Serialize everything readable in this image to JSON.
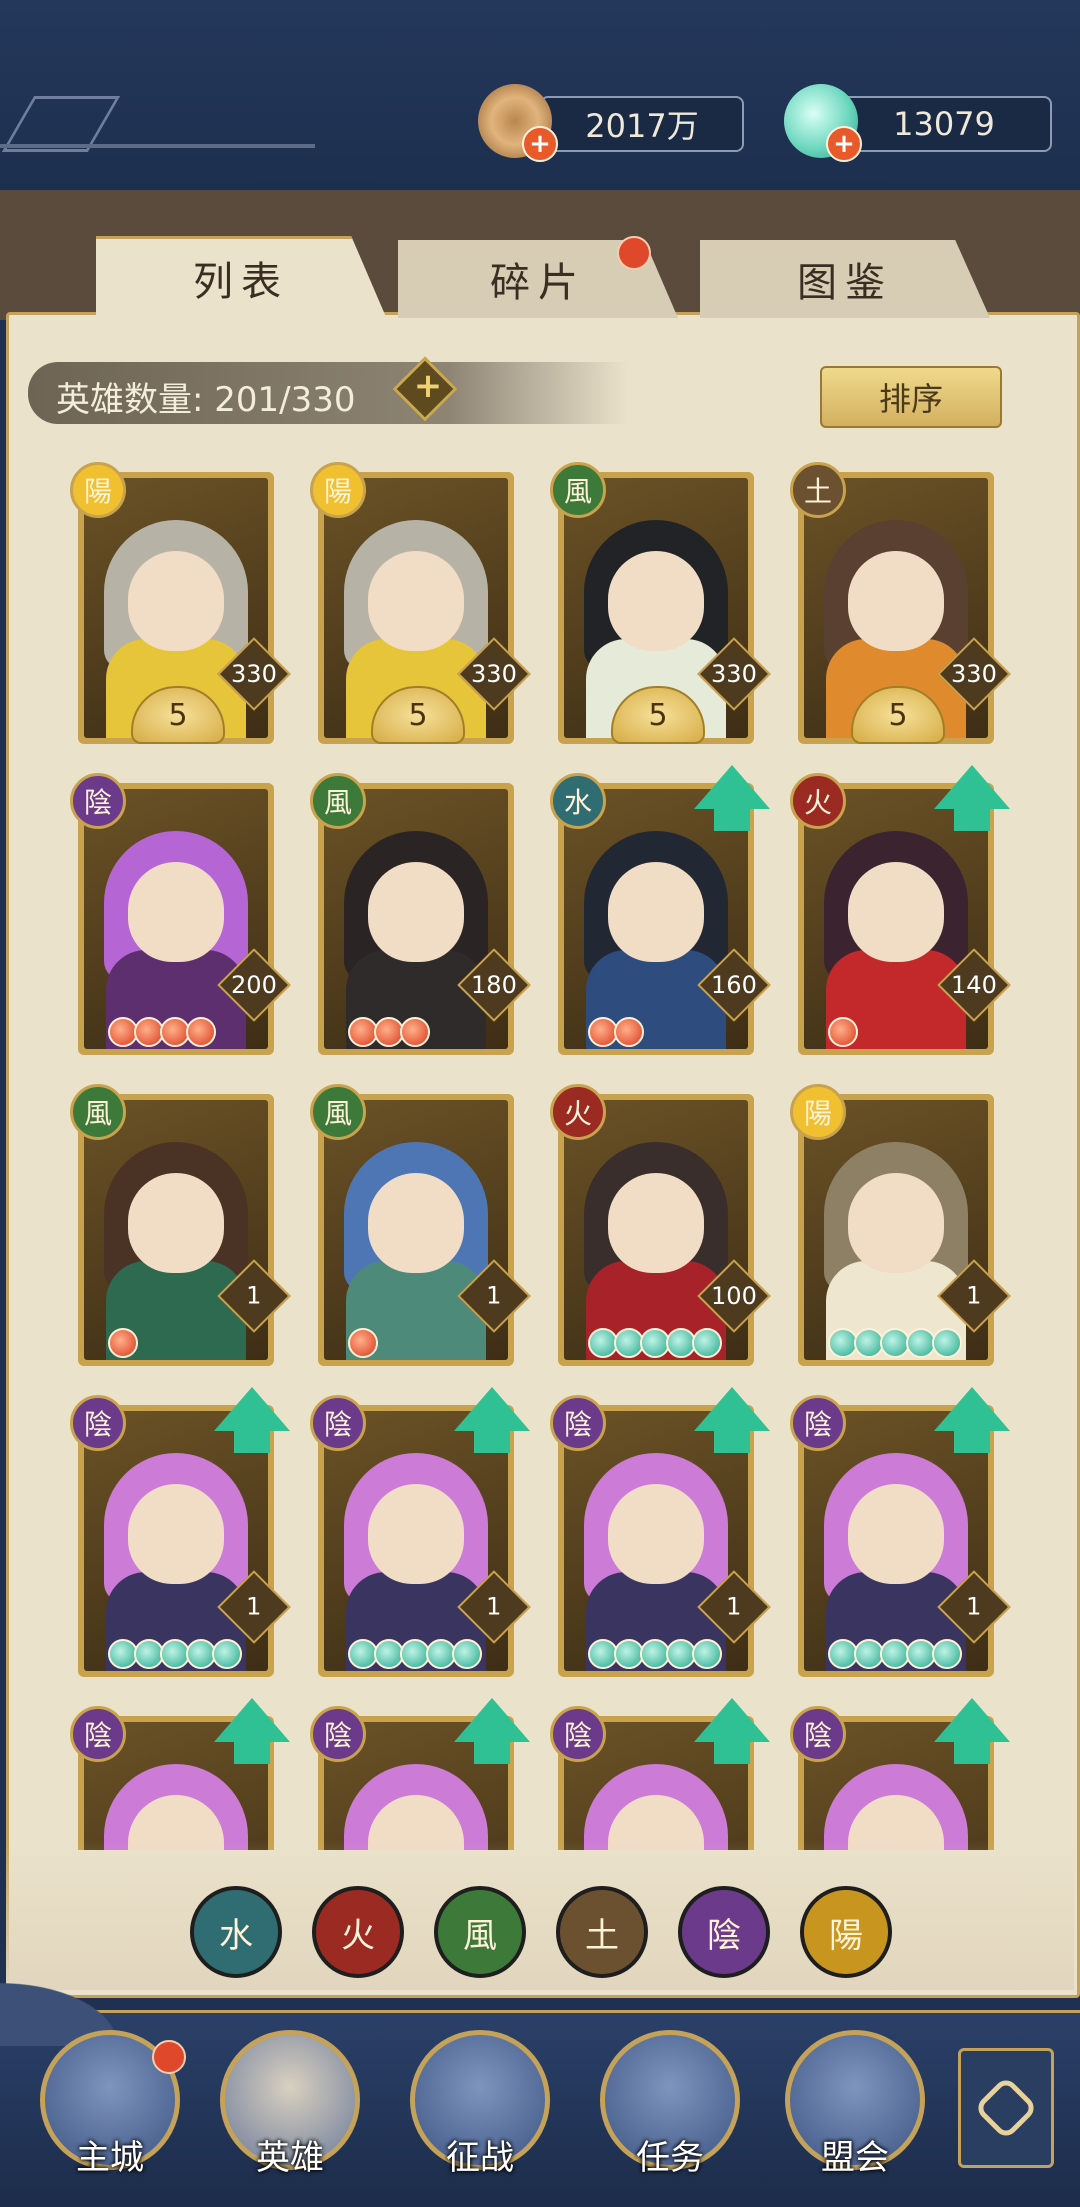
{
  "resources": {
    "coins": "2017万",
    "jade": "13079"
  },
  "tabs": [
    "列表",
    "碎片",
    "图鉴"
  ],
  "hero_count_label": "英雄数量: 201/330",
  "sort_label": "排序",
  "heroes": [
    {
      "element": "陽",
      "stars": "5",
      "level": "330",
      "color": "#f0c030",
      "hair": "#b7b2a6",
      "body": "#e7c53a",
      "upgrade": false,
      "orbs": ""
    },
    {
      "element": "陽",
      "stars": "5",
      "level": "330",
      "color": "#f0c030",
      "hair": "#b7b2a6",
      "body": "#e7c53a",
      "upgrade": false,
      "orbs": ""
    },
    {
      "element": "風",
      "stars": "5",
      "level": "330",
      "color": "#3d7a3a",
      "hair": "#222326",
      "body": "#e6ead9",
      "upgrade": false,
      "orbs": ""
    },
    {
      "element": "土",
      "stars": "5",
      "level": "330",
      "color": "#6b5130",
      "hair": "#5a4030",
      "body": "#e08a2e",
      "upgrade": false,
      "orbs": ""
    },
    {
      "element": "陰",
      "level": "200",
      "color": "#6b3a8a",
      "hair": "#b565d4",
      "body": "#5d2f6e",
      "upgrade": false,
      "orbs": "red",
      "orb_count": 4
    },
    {
      "element": "風",
      "level": "180",
      "color": "#3d7a3a",
      "hair": "#2a2424",
      "body": "#2f2b2a",
      "upgrade": false,
      "orbs": "red",
      "orb_count": 3
    },
    {
      "element": "水",
      "level": "160",
      "color": "#2f6d72",
      "hair": "#222833",
      "body": "#2e4c7e",
      "upgrade": true,
      "orbs": "red",
      "orb_count": 2
    },
    {
      "element": "火",
      "level": "140",
      "color": "#9a2a22",
      "hair": "#3b2430",
      "body": "#c3282a",
      "upgrade": true,
      "orbs": "red",
      "orb_count": 1
    },
    {
      "element": "風",
      "level": "1",
      "color": "#3d7a3a",
      "hair": "#4a3224",
      "body": "#2e6a50",
      "upgrade": false,
      "orbs": "red",
      "orb_count": 1
    },
    {
      "element": "風",
      "level": "1",
      "color": "#3d7a3a",
      "hair": "#4f76b4",
      "body": "#4e8a7a",
      "upgrade": false,
      "orbs": "red",
      "orb_count": 1
    },
    {
      "element": "火",
      "level": "100",
      "color": "#9a2a22",
      "hair": "#3a2e2c",
      "body": "#a8222a",
      "upgrade": false,
      "orbs": "teal",
      "orb_count": 5
    },
    {
      "element": "陽",
      "level": "1",
      "color": "#f0c030",
      "hair": "#8e8064",
      "body": "#efe6cf",
      "upgrade": false,
      "orbs": "teal",
      "orb_count": 5
    },
    {
      "element": "陰",
      "level": "1",
      "color": "#6b3a8a",
      "hair": "#cc7bd6",
      "body": "#3a3560",
      "upgrade": true,
      "orbs": "teal",
      "orb_count": 5
    },
    {
      "element": "陰",
      "level": "1",
      "color": "#6b3a8a",
      "hair": "#cc7bd6",
      "body": "#3a3560",
      "upgrade": true,
      "orbs": "teal",
      "orb_count": 5
    },
    {
      "element": "陰",
      "level": "1",
      "color": "#6b3a8a",
      "hair": "#cc7bd6",
      "body": "#3a3560",
      "upgrade": true,
      "orbs": "teal",
      "orb_count": 5
    },
    {
      "element": "陰",
      "level": "1",
      "color": "#6b3a8a",
      "hair": "#cc7bd6",
      "body": "#3a3560",
      "upgrade": true,
      "orbs": "teal",
      "orb_count": 5
    },
    {
      "element": "陰",
      "level": "",
      "color": "#6b3a8a",
      "hair": "#cc7bd6",
      "body": "#3a3560",
      "upgrade": true,
      "orbs": "",
      "orb_count": 0
    },
    {
      "element": "陰",
      "level": "",
      "color": "#6b3a8a",
      "hair": "#cc7bd6",
      "body": "#3a3560",
      "upgrade": true,
      "orbs": "",
      "orb_count": 0
    },
    {
      "element": "陰",
      "level": "",
      "color": "#6b3a8a",
      "hair": "#cc7bd6",
      "body": "#3a3560",
      "upgrade": true,
      "orbs": "",
      "orb_count": 0
    },
    {
      "element": "陰",
      "level": "",
      "color": "#6b3a8a",
      "hair": "#cc7bd6",
      "body": "#3a3560",
      "upgrade": true,
      "orbs": "",
      "orb_count": 0
    }
  ],
  "element_filters": [
    {
      "glyph": "水",
      "color": "#2f6d72"
    },
    {
      "glyph": "火",
      "color": "#9a2a22"
    },
    {
      "glyph": "風",
      "color": "#3d7a3a"
    },
    {
      "glyph": "土",
      "color": "#6b5130"
    },
    {
      "glyph": "陰",
      "color": "#6b3a8a"
    },
    {
      "glyph": "陽",
      "color": "#c8961e"
    }
  ],
  "nav": [
    "主城",
    "英雄",
    "征战",
    "任务",
    "盟会"
  ],
  "colors": {
    "navy": "#1f3050",
    "gold": "#c4a25a",
    "parchment": "#ebe2cb",
    "upgrade_green": "#2fc093"
  }
}
